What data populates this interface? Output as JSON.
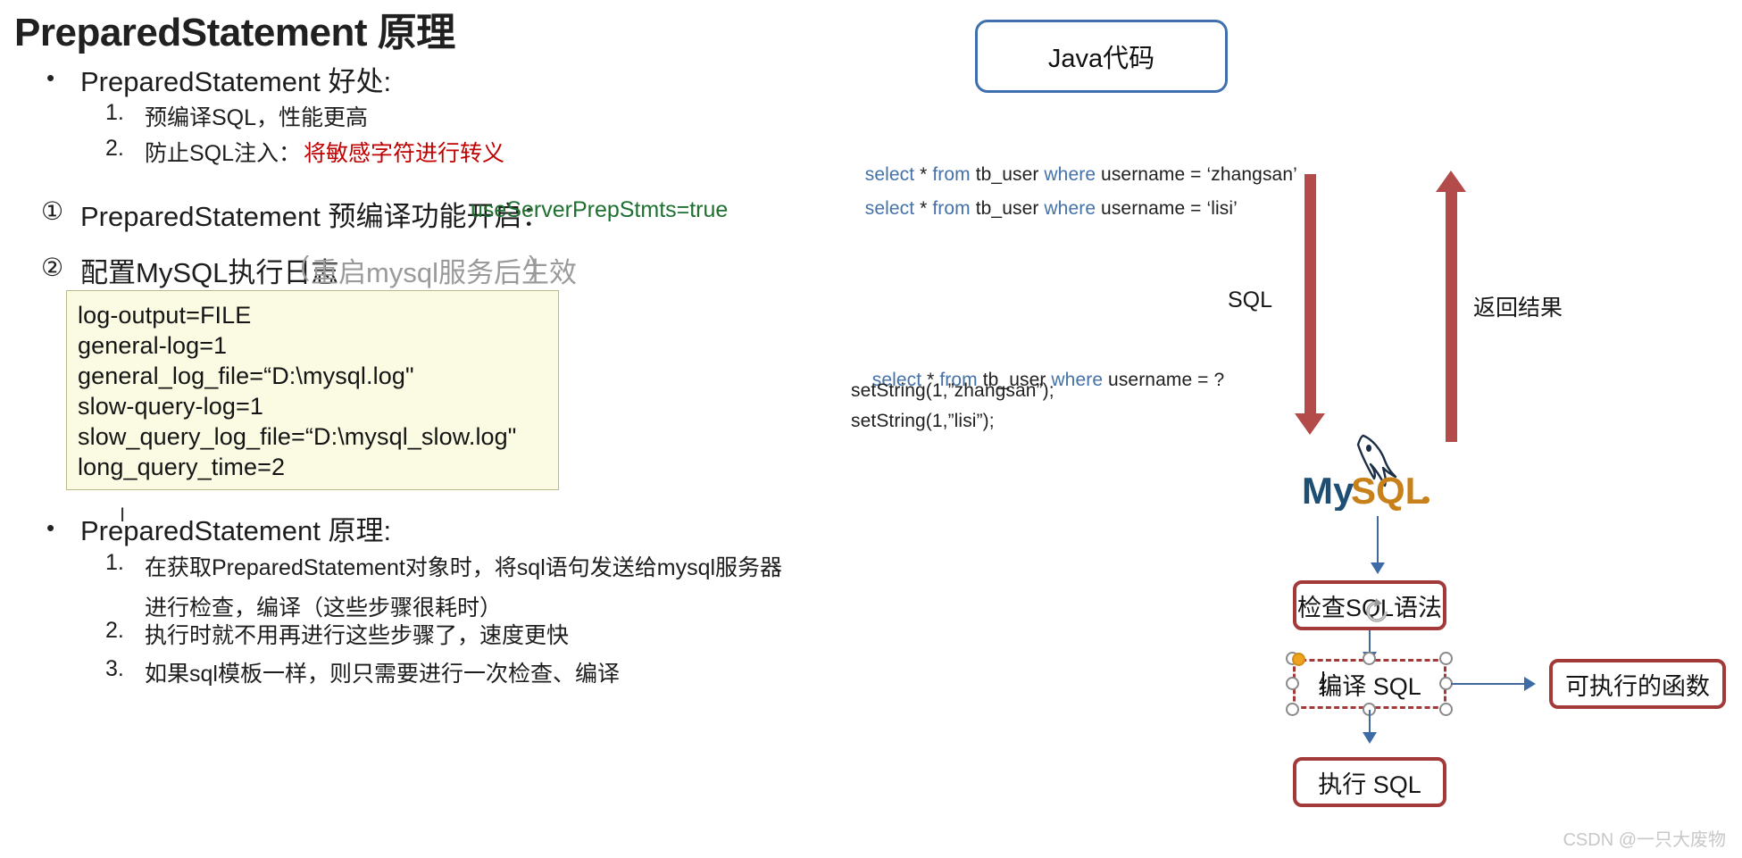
{
  "title": "PreparedStatement 原理",
  "left_panel": {
    "benefits_heading": "PreparedStatement 好处:",
    "benefits": [
      {
        "marker": "1.",
        "text": "预编译SQL，性能更高"
      },
      {
        "marker": "2.",
        "text_plain": "防止SQL注入：",
        "text_red": "将敏感字符进行转义"
      }
    ],
    "steps": [
      {
        "marker": "①",
        "text": "PreparedStatement 预编译功能开启：",
        "value": "useServerPrepStmts=true",
        "value_color": "#1e7030"
      },
      {
        "marker": "②",
        "text": "配置MySQL执行日志",
        "note_open": "(",
        "note": "重启mysql服务后生效",
        "note_close": ")",
        "note_color": "#9a9a9a"
      }
    ],
    "config_box": {
      "lines": [
        "log-output=FILE",
        "general-log=1",
        "general_log_file=“D:\\mysql.log\"",
        "slow-query-log=1",
        "slow_query_log_file=“D:\\mysql_slow.log\"",
        "long_query_time=2"
      ]
    },
    "principle_heading": "PreparedStatement 原理:",
    "principles": [
      {
        "marker": "1.",
        "line1": "在获取PreparedStatement对象时，将sql语句发送给mysql服务器",
        "line2": "进行检查，编译（这些步骤很耗时）"
      },
      {
        "marker": "2.",
        "line1": "执行时就不用再进行这些步骤了，速度更快"
      },
      {
        "marker": "3.",
        "line1": "如果sql模板一样，则只需要进行一次检查、编译"
      }
    ]
  },
  "diagram": {
    "java_box_label": "Java代码",
    "sql_top": [
      {
        "kw1": "select",
        "mid1": " * ",
        "kw2": "from",
        "mid2": " tb_user ",
        "kw3": "where",
        "tail": " username = ‘zhangsan’"
      },
      {
        "kw1": "select",
        "mid1": " * ",
        "kw2": "from",
        "mid2": " tb_user ",
        "kw3": "where",
        "tail": " username = ‘lisi’"
      }
    ],
    "sql_bottom": {
      "line1": {
        "kw1": "select",
        "mid1": " * ",
        "kw2": "from",
        "mid2": " tb_user ",
        "kw3": "where",
        "tail": " username = ?"
      },
      "line2": "setString(1,”zhangsan”);",
      "line3": "setString(1,”lisi”);"
    },
    "down_arrow_label": "SQL",
    "up_arrow_label": "返回结果",
    "mysql_logo_label": "MySQL",
    "flow": {
      "check": "检查SQL语法",
      "compile": "编译 SQL",
      "execute": "执行 SQL",
      "function": "可执行的函数"
    },
    "colors": {
      "blue_box_border": "#3f6fac",
      "red_arrow": "#b44b4b",
      "red_box_border": "#a33a3a",
      "blue_connector": "#3c6ba5",
      "sql_keyword": "#4472a8",
      "rotate_handle": "#f0a21e"
    }
  },
  "watermark": "CSDN @一只大废物"
}
